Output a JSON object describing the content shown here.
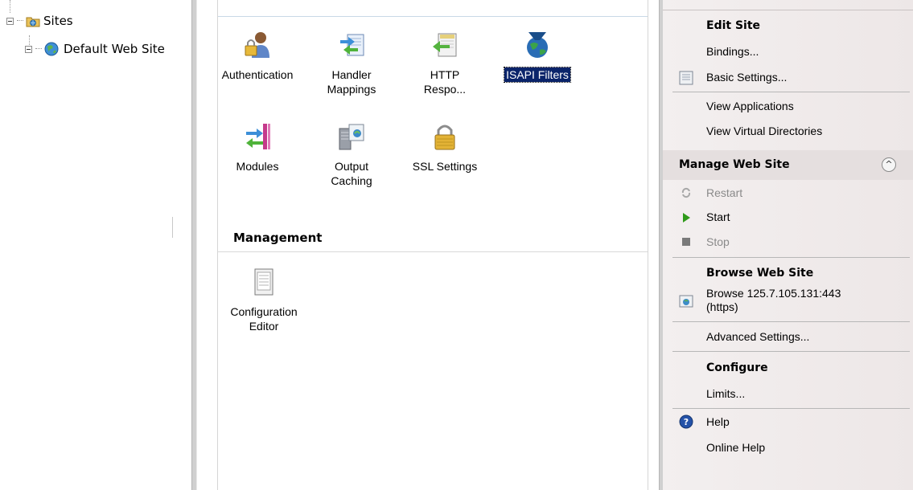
{
  "tree": {
    "sites_label": "Sites",
    "default_site_label": "Default Web Site"
  },
  "features": {
    "authentication": "Authentication",
    "handler_mappings_1": "Handler",
    "handler_mappings_2": "Mappings",
    "http_response_1": "HTTP",
    "http_response_2": "Respo...",
    "isapi_filters": "ISAPI Filters",
    "modules": "Modules",
    "output_caching_1": "Output",
    "output_caching_2": "Caching",
    "ssl_settings": "SSL Settings",
    "management_header": "Management",
    "config_editor_1": "Configuration",
    "config_editor_2": "Editor"
  },
  "actions": {
    "edit_site": "Edit Site",
    "bindings": "Bindings...",
    "basic_settings": "Basic Settings...",
    "view_applications": "View Applications",
    "view_virtual_directories": "View Virtual Directories",
    "manage_web_site": "Manage Web Site",
    "restart": "Restart",
    "start": "Start",
    "stop": "Stop",
    "browse_web_site": "Browse Web Site",
    "browse_link_1": "Browse 125.7.105.131:443",
    "browse_link_2": "(https)",
    "advanced_settings": "Advanced Settings...",
    "configure": "Configure",
    "limits": "Limits...",
    "help": "Help",
    "online_help": "Online Help"
  },
  "icons": {
    "sites": "folder-globe-icon",
    "default_site": "globe-icon",
    "authentication": "lock-user-icon",
    "handler_mappings": "arrows-doc-icon",
    "http_response": "doc-arrow-icon",
    "isapi_filters": "funnel-globe-icon",
    "modules": "arrows-bars-icon",
    "output_caching": "server-doc-icon",
    "ssl_settings": "padlock-icon",
    "configuration_editor": "doc-list-icon",
    "basic_settings": "settings-doc-icon",
    "restart": "restart-icon",
    "start": "play-icon",
    "stop": "stop-icon",
    "browse": "browse-globe-icon",
    "help": "help-icon",
    "collapse": "chevron-up-icon"
  },
  "colors": {
    "selection": "#0a246a",
    "start_green": "#2f9a1a",
    "help_blue": "#2452a8"
  }
}
